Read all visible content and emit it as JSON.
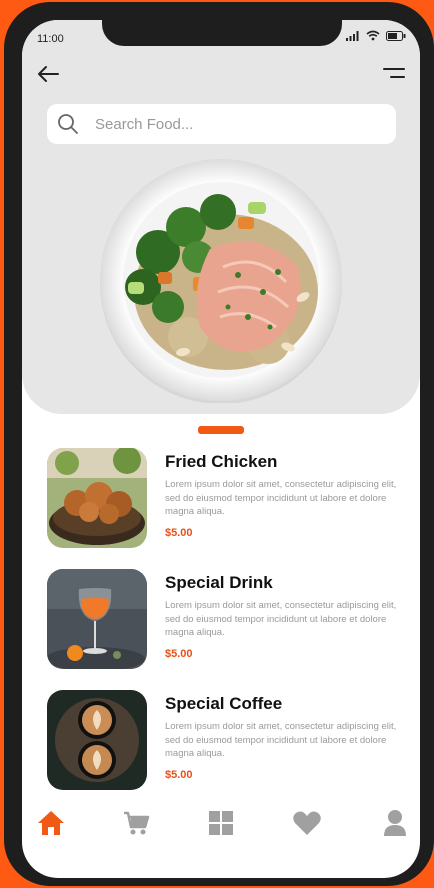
{
  "status": {
    "time": "11:00"
  },
  "search": {
    "placeholder": "Search Food..."
  },
  "items": [
    {
      "title": "Fried Chicken",
      "desc": "Lorem ipsum dolor sit amet, consectetur adipiscing elit, sed do eiusmod tempor incididunt ut labore et dolore magna aliqua.",
      "price": "$5.00"
    },
    {
      "title": "Special Drink",
      "desc": "Lorem ipsum dolor sit amet, consectetur adipiscing elit, sed do eiusmod tempor incididunt ut labore et dolore magna aliqua.",
      "price": "$5.00"
    },
    {
      "title": "Special Coffee",
      "desc": "Lorem ipsum dolor sit amet, consectetur adipiscing elit, sed do eiusmod tempor incididunt ut labore et dolore magna aliqua.",
      "price": "$5.00"
    }
  ],
  "tabs": [
    {
      "icon": "home-icon",
      "active": true
    },
    {
      "icon": "cart-icon",
      "active": false
    },
    {
      "icon": "grid-icon",
      "active": false
    },
    {
      "icon": "heart-icon",
      "active": false
    },
    {
      "icon": "user-icon",
      "active": false
    }
  ],
  "colors": {
    "accent": "#f05a14",
    "price": "#e8501a",
    "hero_bg": "#e6e6e6",
    "inactive_icon": "#a0a0a0"
  }
}
